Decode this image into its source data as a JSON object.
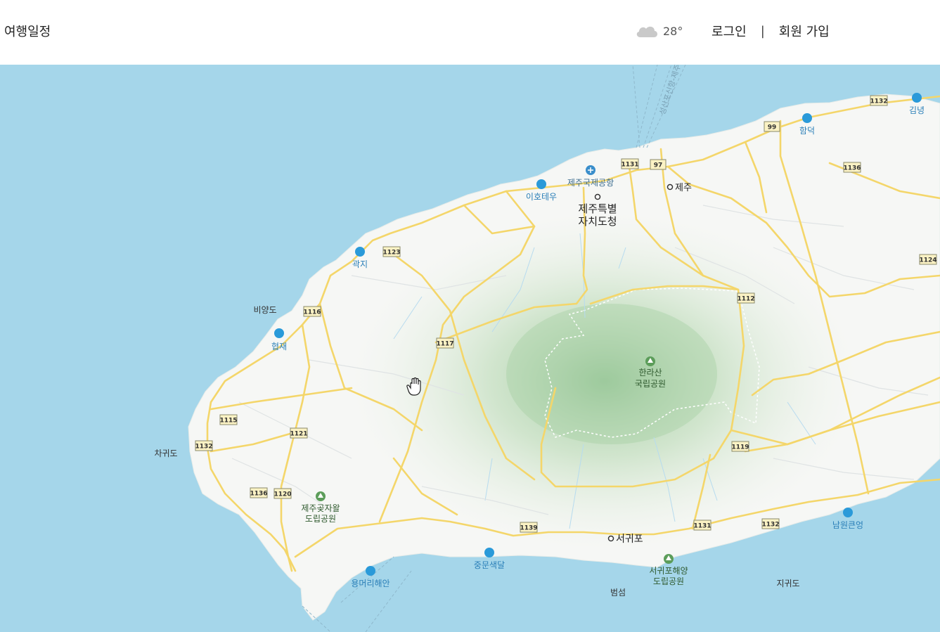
{
  "header": {
    "brand": "여행일정",
    "weather": {
      "icon": "cloud-icon",
      "temp": "28°"
    },
    "login": "로그인",
    "separator": "|",
    "signup": "회원 가입"
  },
  "colors": {
    "sea": "#a5d6ea",
    "land": "#f6f7f5",
    "road": "#f4d66a",
    "forest": "#8ec18f",
    "poi": "#2a9ad9",
    "park": "#5c9d5a"
  },
  "map": {
    "places": [
      {
        "id": "jeju-airport",
        "label": "제주국제공항",
        "icon": "airplane-icon"
      },
      {
        "id": "jeju-city-hall",
        "label_line1": "제주특별",
        "label_line2": "자치도청",
        "icon": "dot-icon"
      },
      {
        "id": "jeju",
        "label": "제주",
        "icon": "dot-icon"
      },
      {
        "id": "ihotewoo",
        "label": "이호테우",
        "icon": "beach-icon"
      },
      {
        "id": "gwakji",
        "label": "곽지",
        "icon": "beach-icon"
      },
      {
        "id": "biyangdo",
        "label": "비양도"
      },
      {
        "id": "hyeopjae",
        "label": "협재",
        "icon": "beach-icon"
      },
      {
        "id": "chagwido",
        "label": "차귀도"
      },
      {
        "id": "hamdeok",
        "label": "함덕",
        "icon": "beach-icon"
      },
      {
        "id": "gimnyeong",
        "label": "김녕",
        "icon": "beach-icon"
      },
      {
        "id": "hallasan",
        "label_line1": "한라산",
        "label_line2": "국립공원",
        "icon": "tree-icon"
      },
      {
        "id": "gotjawal",
        "label_line1": "제주곶자왈",
        "label_line2": "도립공원",
        "icon": "tree-icon"
      },
      {
        "id": "seogwipo",
        "label": "서귀포",
        "icon": "dot-icon"
      },
      {
        "id": "jungmun",
        "label": "중문색달",
        "icon": "beach-icon"
      },
      {
        "id": "yongmeori",
        "label": "용머리해안",
        "icon": "beach-icon"
      },
      {
        "id": "seogwipo-marine",
        "label_line1": "서귀포해양",
        "label_line2": "도립공원",
        "icon": "tree-icon"
      },
      {
        "id": "beomseom",
        "label": "범섬"
      },
      {
        "id": "jigwido",
        "label": "지귀도"
      },
      {
        "id": "namwon",
        "label": "남원큰엉",
        "icon": "beach-icon"
      },
      {
        "id": "ferry",
        "label": "성산포신항-제주"
      }
    ],
    "road_shields": [
      "1131",
      "97",
      "99",
      "1132",
      "1136",
      "1124",
      "1123",
      "1116",
      "1117",
      "1112",
      "1115",
      "1132",
      "1121",
      "1136",
      "1120",
      "1139",
      "1131",
      "1132",
      "1119"
    ]
  }
}
